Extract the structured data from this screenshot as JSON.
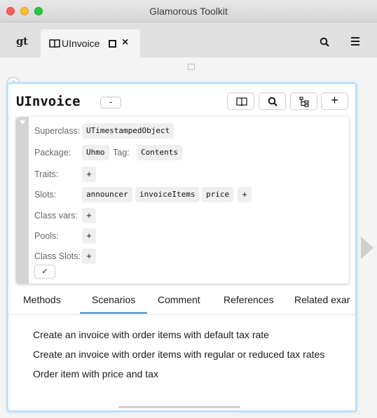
{
  "window": {
    "title": "Glamorous Toolkit"
  },
  "tabbar": {
    "logo": "gt",
    "tab_label": "UInvoice",
    "tab_close": "×",
    "search_icon": "search-icon",
    "menu_icon": "hamburger-menu-icon"
  },
  "content": {
    "add_pane_symbol": "+"
  },
  "pane": {
    "title": "UInvoice",
    "collapse_label": "-",
    "add_label": "+",
    "definition": {
      "superclass_label": "Superclass:",
      "superclass_value": "UTimestampedObject",
      "package_label": "Package:",
      "package_value": "Uhmo",
      "tag_label": "Tag:",
      "tag_value": "Contents",
      "traits_label": "Traits:",
      "slots_label": "Slots:",
      "slots": [
        "announcer",
        "invoiceItems",
        "price"
      ],
      "classvars_label": "Class vars:",
      "pools_label": "Pools:",
      "classslots_label": "Class Slots:",
      "plus": "+",
      "accept_label": "✓"
    },
    "tabs": [
      "Methods",
      "Scenarios",
      "Comment",
      "References",
      "Related exar"
    ],
    "active_tab": "Scenarios",
    "scenarios": [
      "Create an invoice with order items with default tax rate",
      "Create an invoice with order items with regular or reduced tax rates",
      "Order item with price and tax"
    ]
  },
  "colors": {
    "accent": "#3f87c7",
    "pane_glow": "#bfe0f7",
    "chip_bg": "#efefef"
  }
}
